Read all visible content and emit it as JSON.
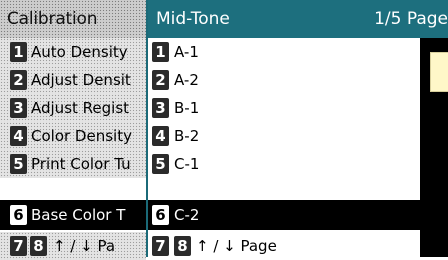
{
  "left_panel": {
    "title": "Calibration",
    "items": [
      {
        "num": "1",
        "label": "Auto Density"
      },
      {
        "num": "2",
        "label": "Adjust Densit"
      },
      {
        "num": "3",
        "label": "Adjust Regist"
      },
      {
        "num": "4",
        "label": "Color Density"
      },
      {
        "num": "5",
        "label": "Print Color Tu"
      },
      {
        "num": "6",
        "label": "Base Color T",
        "selected": true
      }
    ],
    "page_nav": {
      "num1": "7",
      "num2": "8",
      "label": "↑ / ↓ Pa"
    }
  },
  "right_panel": {
    "title": "Mid-Tone",
    "page_indicator": "1/5 Page",
    "items": [
      {
        "num": "1",
        "label": "A-1"
      },
      {
        "num": "2",
        "label": "A-2"
      },
      {
        "num": "3",
        "label": "B-1"
      },
      {
        "num": "4",
        "label": "B-2"
      },
      {
        "num": "5",
        "label": "C-1"
      },
      {
        "num": "6",
        "label": "C-2",
        "selected": true
      }
    ],
    "page_nav": {
      "num1": "7",
      "num2": "8",
      "label": "↑ / ↓ Page"
    }
  },
  "colors": {
    "header_teal": "#1d6f7e",
    "selected_bg": "#000000",
    "swatch": "#fff7c8"
  }
}
